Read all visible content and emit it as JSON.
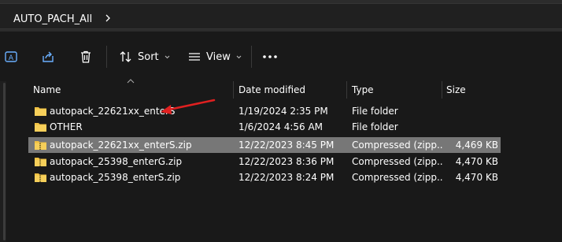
{
  "address": {
    "breadcrumb": "AUTO_PACH_All"
  },
  "commandbar": {
    "sort_label": "Sort",
    "view_label": "View",
    "icons": [
      "rename-icon",
      "share-icon",
      "delete-icon",
      "sort-icon",
      "view-icon",
      "more-icon"
    ]
  },
  "columns": {
    "name": "Name",
    "date": "Date modified",
    "type": "Type",
    "size": "Size"
  },
  "files": [
    {
      "name": "autopack_22621xx_enterS",
      "date": "1/19/2024 2:35 PM",
      "type": "File folder",
      "size": "",
      "kind": "folder",
      "selected": false
    },
    {
      "name": "OTHER",
      "date": "1/6/2024 4:56 AM",
      "type": "File folder",
      "size": "",
      "kind": "folder",
      "selected": false
    },
    {
      "name": "autopack_22621xx_enterS.zip",
      "date": "12/22/2023 8:45 PM",
      "type": "Compressed (zipp...",
      "size": "4,469 KB",
      "kind": "zip",
      "selected": true
    },
    {
      "name": "autopack_25398_enterG.zip",
      "date": "12/22/2023 8:36 PM",
      "type": "Compressed (zipp...",
      "size": "4,470 KB",
      "kind": "zip",
      "selected": false
    },
    {
      "name": "autopack_25398_enterS.zip",
      "date": "12/22/2023 8:24 PM",
      "type": "Compressed (zipp...",
      "size": "4,470 KB",
      "kind": "zip",
      "selected": false
    }
  ],
  "colors": {
    "background": "#191919",
    "selection": "#777777",
    "folder": "#f0c042",
    "annotation_arrow": "#e02020"
  }
}
